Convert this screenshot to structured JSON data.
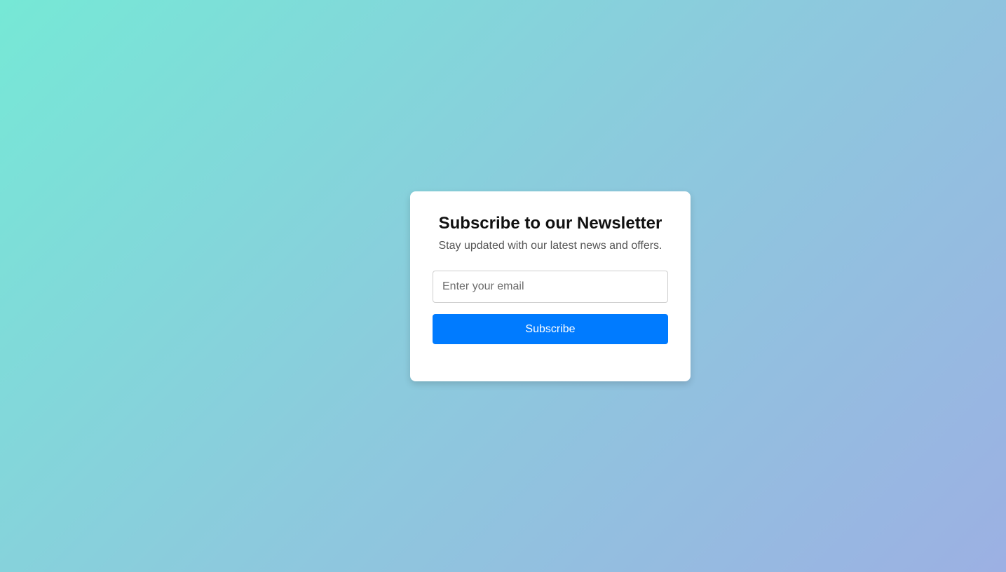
{
  "newsletter": {
    "title": "Subscribe to our Newsletter",
    "subtitle": "Stay updated with our latest news and offers.",
    "email_placeholder": "Enter your email",
    "email_value": "",
    "subscribe_label": "Subscribe"
  },
  "colors": {
    "background_gradient_start": "#76e8d6",
    "background_gradient_end": "#9cb0e3",
    "card_background": "#ffffff",
    "button_background": "#007bff",
    "button_text": "#ffffff",
    "title_text": "#111111",
    "subtitle_text": "#555555"
  }
}
